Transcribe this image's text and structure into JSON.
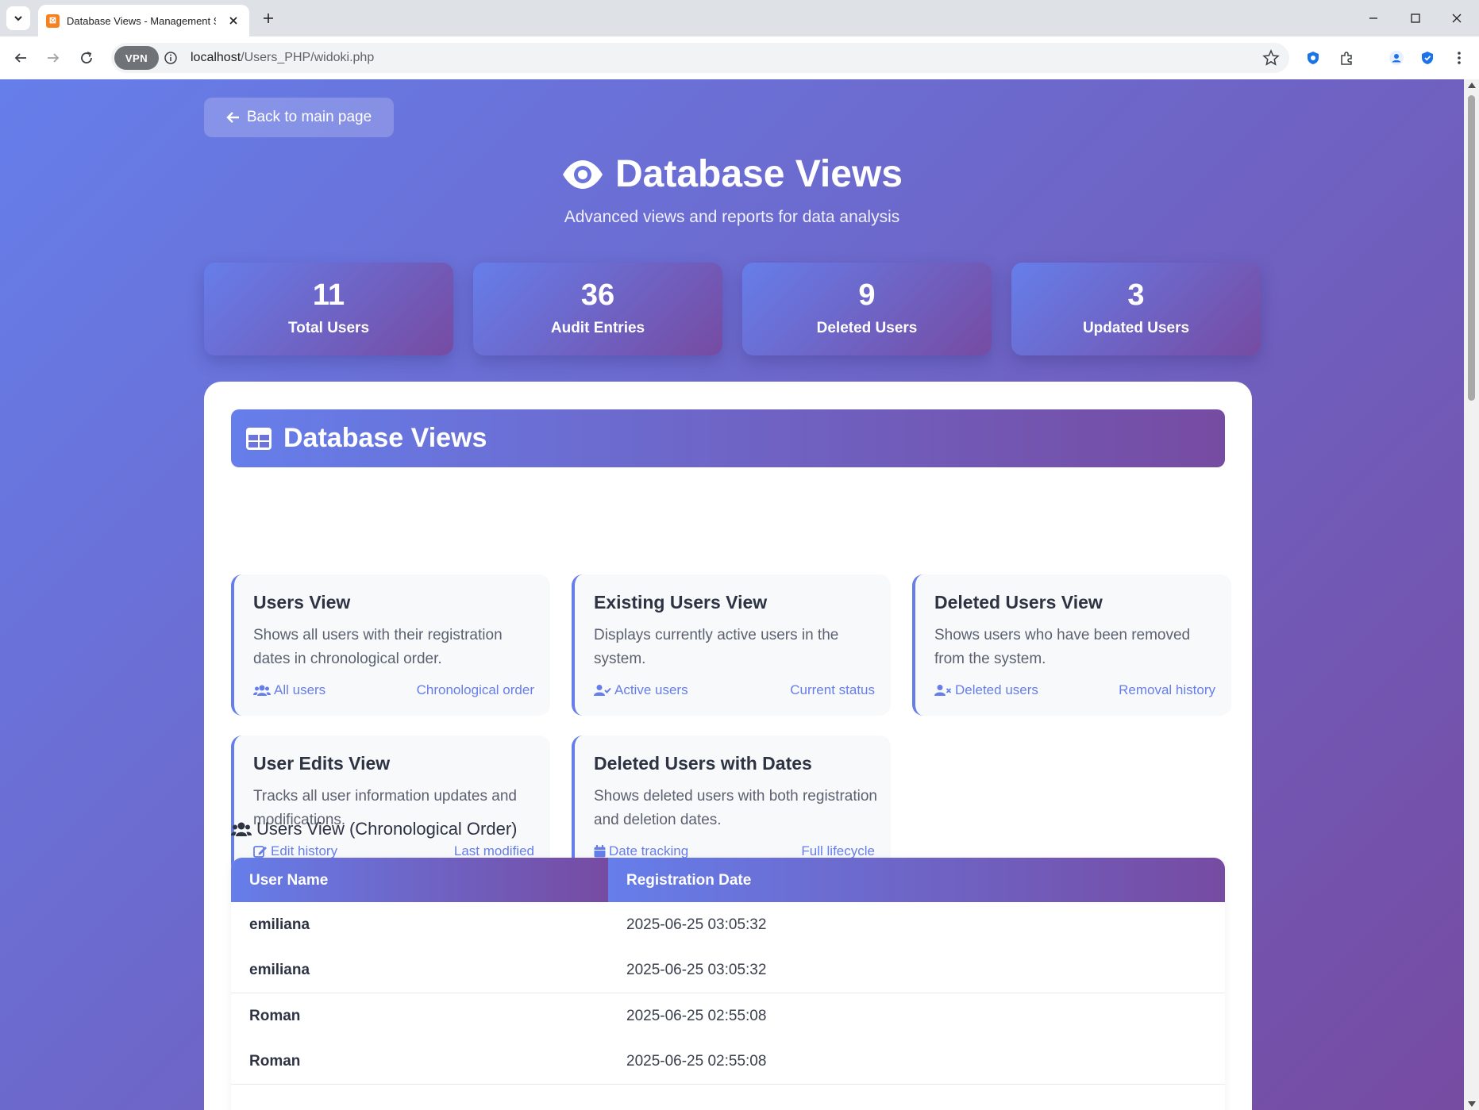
{
  "browser": {
    "tab_title": "Database Views - Management Sy",
    "url_host": "localhost",
    "url_path": "/Users_PHP/widoki.php",
    "vpn_label": "VPN"
  },
  "page": {
    "back_label": "Back to main page",
    "title": "Database Views",
    "subtitle": "Advanced views and reports for data analysis"
  },
  "stats": [
    {
      "value": "11",
      "label": "Total Users"
    },
    {
      "value": "36",
      "label": "Audit Entries"
    },
    {
      "value": "9",
      "label": "Deleted Users"
    },
    {
      "value": "3",
      "label": "Updated Users"
    }
  ],
  "panel": {
    "header": "Database Views",
    "views": [
      {
        "title": "Users View",
        "desc": "Shows all users with their registration dates in chronological order.",
        "tag_left": "All users",
        "tag_right": "Chronological order",
        "icon": "users-icon"
      },
      {
        "title": "Existing Users View",
        "desc": "Displays currently active users in the system.",
        "tag_left": "Active users",
        "tag_right": "Current status",
        "icon": "user-check-icon"
      },
      {
        "title": "Deleted Users View",
        "desc": "Shows users who have been removed from the system.",
        "tag_left": "Deleted users",
        "tag_right": "Removal history",
        "icon": "user-x-icon"
      },
      {
        "title": "User Edits View",
        "desc": "Tracks all user information updates and modifications.",
        "tag_left": "Edit history",
        "tag_right": "Last modified",
        "icon": "edit-icon"
      },
      {
        "title": "Deleted Users with Dates",
        "desc": "Shows deleted users with both registration and deletion dates.",
        "tag_left": "Date tracking",
        "tag_right": "Full lifecycle",
        "icon": "calendar-icon"
      }
    ]
  },
  "table": {
    "title": "Users View (Chronological Order)",
    "columns": [
      "User Name",
      "Registration Date"
    ],
    "rows": [
      {
        "name": "emiliana",
        "date": "2025-06-25 03:05:32"
      },
      {
        "name": "emiliana",
        "date": "2025-06-25 03:05:32"
      },
      {
        "name": "Roman",
        "date": "2025-06-25 02:55:08"
      },
      {
        "name": "Roman",
        "date": "2025-06-25 02:55:08"
      }
    ]
  },
  "colors": {
    "gradient_start": "#667eea",
    "gradient_end": "#764ba2"
  }
}
